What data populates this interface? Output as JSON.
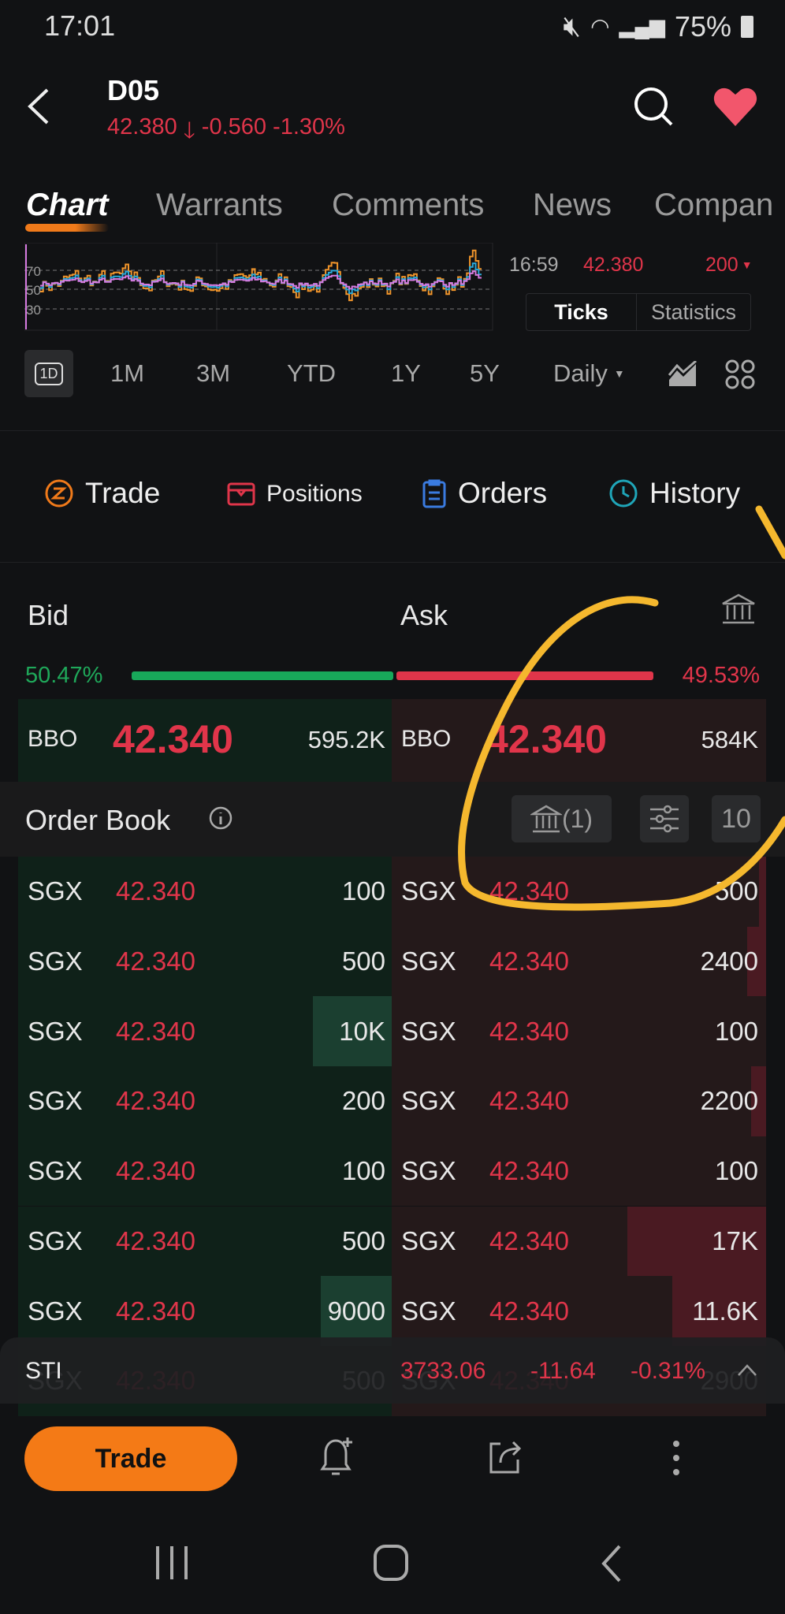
{
  "status_bar": {
    "time": "17:01",
    "battery": "75%",
    "icons": [
      "mute-icon",
      "battery-saver-icon",
      "wifi-icon",
      "wifi-call-icon",
      "signal-icon",
      "battery-icon"
    ]
  },
  "header": {
    "symbol": "D05",
    "price": "42.380",
    "change": "-0.560",
    "change_pct": "-1.30%",
    "direction": "down"
  },
  "tabs": [
    {
      "label": "Chart",
      "active": true
    },
    {
      "label": "Warrants"
    },
    {
      "label": "Comments"
    },
    {
      "label": "News"
    },
    {
      "label": "Compan"
    }
  ],
  "mini_chart": {
    "levels": [
      "70",
      "50",
      "30"
    ],
    "series_colors": [
      "#f0942a",
      "#29a9d8",
      "#d67be0"
    ]
  },
  "tick_info": {
    "time": "16:59",
    "price": "42.380",
    "volume": "200"
  },
  "tick_tabs": [
    {
      "label": "Ticks",
      "active": true
    },
    {
      "label": "Statistics"
    }
  ],
  "periods": [
    {
      "label": "1D",
      "active": true
    },
    {
      "label": "1M"
    },
    {
      "label": "3M"
    },
    {
      "label": "YTD"
    },
    {
      "label": "1Y"
    },
    {
      "label": "5Y"
    }
  ],
  "interval": "Daily",
  "quick_tabs": [
    {
      "label": "Trade",
      "icon": "trade-icon",
      "color": "#f07a1a"
    },
    {
      "label": "Positions",
      "icon": "positions-icon",
      "color": "#e0354a"
    },
    {
      "label": "Orders",
      "icon": "orders-icon",
      "color": "#3a7be0"
    },
    {
      "label": "History",
      "icon": "history-icon",
      "color": "#1fa5b8"
    }
  ],
  "bidask": {
    "bid_label": "Bid",
    "ask_label": "Ask",
    "bid_pct": "50.47%",
    "ask_pct": "49.53%",
    "bid_ratio": 50.47,
    "bbo_label": "BBO",
    "bid_price": "42.340",
    "bid_size": "595.2K",
    "ask_price": "42.340",
    "ask_size": "584K"
  },
  "order_book": {
    "title": "Order Book",
    "broker_count": "(1)",
    "depth": "10",
    "bids": [
      {
        "exchange": "SGX",
        "price": "42.340",
        "size": "100",
        "depth": 0
      },
      {
        "exchange": "SGX",
        "price": "42.340",
        "size": "500",
        "depth": 0
      },
      {
        "exchange": "SGX",
        "price": "42.340",
        "size": "10K",
        "depth": 21
      },
      {
        "exchange": "SGX",
        "price": "42.340",
        "size": "200",
        "depth": 0
      },
      {
        "exchange": "SGX",
        "price": "42.340",
        "size": "100",
        "depth": 0
      },
      {
        "exchange": "SGX",
        "price": "42.340",
        "size": "500",
        "depth": 0
      },
      {
        "exchange": "SGX",
        "price": "42.340",
        "size": "9000",
        "depth": 19
      },
      {
        "exchange": "SGX",
        "price": "42.340",
        "size": "500",
        "depth": 0
      }
    ],
    "asks": [
      {
        "exchange": "SGX",
        "price": "42.340",
        "size": "500",
        "depth": 2
      },
      {
        "exchange": "SGX",
        "price": "42.340",
        "size": "2400",
        "depth": 5
      },
      {
        "exchange": "SGX",
        "price": "42.340",
        "size": "100",
        "depth": 0
      },
      {
        "exchange": "SGX",
        "price": "42.340",
        "size": "2200",
        "depth": 4
      },
      {
        "exchange": "SGX",
        "price": "42.340",
        "size": "100",
        "depth": 0
      },
      {
        "exchange": "SGX",
        "price": "42.340",
        "size": "17K",
        "depth": 37
      },
      {
        "exchange": "SGX",
        "price": "42.340",
        "size": "11.6K",
        "depth": 25
      },
      {
        "exchange": "SGX",
        "price": "42.340",
        "size": "2900",
        "depth": 0
      }
    ]
  },
  "index_bar": {
    "name": "STI",
    "value": "3733.06",
    "change": "-11.64",
    "change_pct": "-0.31%"
  },
  "bottom": {
    "trade_label": "Trade"
  },
  "annotation_color": "#f5b82e"
}
